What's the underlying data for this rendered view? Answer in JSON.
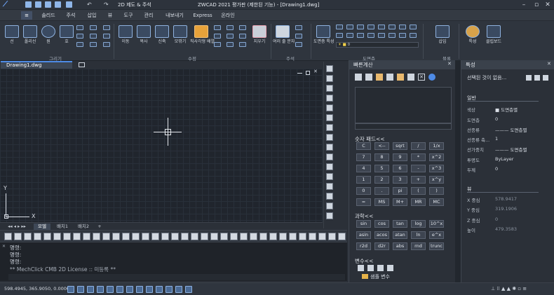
{
  "titlebar": {
    "workspace": "2D 제도 & 주석",
    "title": "ZWCAD 2021 평가판 (제한된 기능) - [Drawing1.dwg]"
  },
  "menu": {
    "tabs": [
      "솔리드",
      "주석",
      "삽입",
      "뷰",
      "도구",
      "관리",
      "내보내기",
      "Express",
      "온라인"
    ]
  },
  "ribbon": {
    "draw": {
      "line": "선",
      "polyline": "폴리선",
      "circle": "원",
      "arc": "호"
    },
    "modify": {
      "move": "이동",
      "copy": "복사",
      "stretch": "신축",
      "fillet": "모깎기",
      "array": "직사각형 배열",
      "erase": "지우기"
    },
    "annotation": {
      "mtext": "여러 줄 문자"
    },
    "layers": {
      "layer_props": "도면층 특성",
      "current_layer": "0"
    },
    "insert": {
      "insert": "삽입"
    },
    "utilities": {
      "properties": "특성",
      "clipboard": "클립보드"
    },
    "groups": {
      "draw": "그리기",
      "modify": "수정",
      "annotation": "주석",
      "layers": "도면층",
      "insert": "블록"
    }
  },
  "document": {
    "tab": "Drawing1.dwg"
  },
  "ucs": {
    "x": "X",
    "y": "Y"
  },
  "layouts": {
    "tabs": [
      "모델",
      "배치1",
      "배치2",
      "+"
    ]
  },
  "command": {
    "lines": [
      "명령:",
      "명령:",
      "명령:",
      "** MechClick CMB 2D License :: 미등록 **"
    ]
  },
  "status": {
    "coords": "598.4945, 365.9050, 0.0000"
  },
  "quickcalc": {
    "title": "빠른계산",
    "numpad_title": "숫자 패드<<",
    "numpad": [
      "C",
      "<--",
      "sqrt",
      "/",
      "1/x",
      "7",
      "8",
      "9",
      "*",
      "x^2",
      "4",
      "5",
      "6",
      "-",
      "x^3",
      "1",
      "2",
      "3",
      "+",
      "x^y",
      "0",
      ".",
      "pi",
      "(",
      ")",
      "=",
      "MS",
      "M+",
      "MR",
      "MC"
    ],
    "sci_title": "과학<<",
    "sci": [
      "sin",
      "cos",
      "tan",
      "log",
      "10^x",
      "asin",
      "acos",
      "atan",
      "ln",
      "e^x",
      "r2d",
      "d2r",
      "abs",
      "rnd",
      "trunc"
    ],
    "vars_title": "변수<<",
    "var_item": "샘플 변수"
  },
  "properties": {
    "title": "특성",
    "selector": "선택된 것이 없음...",
    "general_header": "일반",
    "general": [
      [
        "색상",
        "■ 도면층별"
      ],
      [
        "도면층",
        "0"
      ],
      [
        "선종류",
        "——— 도면층별"
      ],
      [
        "선종류 축...",
        "1"
      ],
      [
        "선가중치",
        "——— 도면층별"
      ],
      [
        "투명도",
        "ByLayer"
      ],
      [
        "두께",
        "0"
      ]
    ],
    "geometry_header": "뷰",
    "geometry": [
      [
        "X 중심",
        "578.9417"
      ],
      [
        "Y 중심",
        "319.1906"
      ],
      [
        "Z 중심",
        "0"
      ],
      [
        "높이",
        "479.3583"
      ]
    ]
  }
}
